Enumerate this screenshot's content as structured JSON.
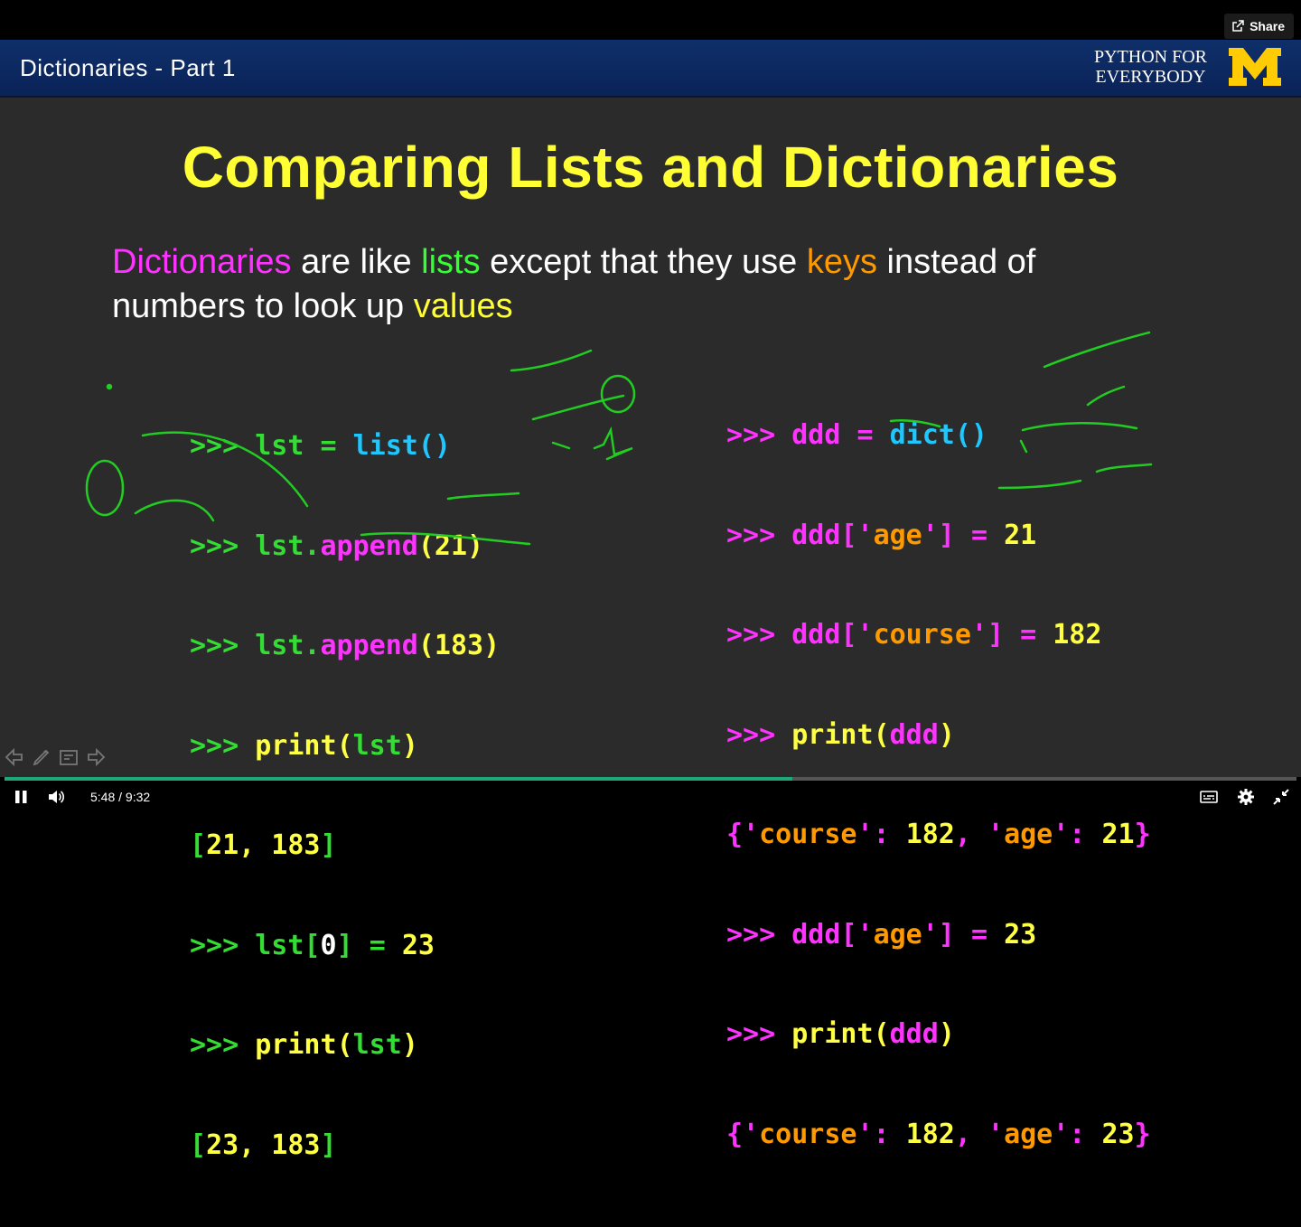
{
  "window": {
    "share_label": "Share"
  },
  "header": {
    "lecture_title": "Dictionaries - Part 1",
    "brand_line1": "PYTHON FOR",
    "brand_line2": "EVERYBODY",
    "logo_letter": "M"
  },
  "slide": {
    "title": "Comparing Lists and Dictionaries",
    "intro": {
      "w1": "Dictionaries",
      "t1": " are like ",
      "w2": "lists",
      "t2": " except that they use ",
      "w3": "keys",
      "t3": " instead of",
      "t4": "numbers to look up ",
      "w4": "values"
    }
  },
  "code_left": {
    "prompt": ">>>",
    "l1_var": "lst",
    "l1_eq": "=",
    "l1_fn": "list()",
    "l2_var": "lst",
    "l2_dot": ".",
    "l2_fn": "append",
    "l2_args": "(21)",
    "l3_var": "lst",
    "l3_dot": ".",
    "l3_fn": "append",
    "l3_args": "(183)",
    "l4_fn": "print",
    "l4_open": "(",
    "l4_arg": "lst",
    "l4_close": ")",
    "o1_open": "[",
    "o1_body": "21, 183",
    "o1_close": "]",
    "l5_var": "lst",
    "l5_b1": "[",
    "l5_idx": "0",
    "l5_b2": "]",
    "l5_eq": "=",
    "l5_val": "23",
    "l6_fn": "print",
    "l6_open": "(",
    "l6_arg": "lst",
    "l6_close": ")",
    "o2_open": "[",
    "o2_body": "23, 183",
    "o2_close": "]"
  },
  "code_right": {
    "prompt": ">>>",
    "r1_var": "ddd",
    "r1_eq": "=",
    "r1_fn": "dict()",
    "r2_var": "ddd",
    "r2_b1": "['",
    "r2_key": "age",
    "r2_b2": "']",
    "r2_eq": "=",
    "r2_val": "21",
    "r3_var": "ddd",
    "r3_b1": "['",
    "r3_key": "course",
    "r3_b2": "']",
    "r3_eq": "=",
    "r3_val": "182",
    "r4_fn": "print",
    "r4_open": "(",
    "r4_arg": "ddd",
    "r4_close": ")",
    "o1_open": "{'",
    "o1_k1": "course",
    "o1_sep1": "': ",
    "o1_v1": "182",
    "o1_comma": ", '",
    "o1_k2": "age",
    "o1_sep2": "': ",
    "o1_v2": "21",
    "o1_close": "}",
    "r5_var": "ddd",
    "r5_b1": "['",
    "r5_key": "age",
    "r5_b2": "']",
    "r5_eq": "=",
    "r5_val": "23",
    "r6_fn": "print",
    "r6_open": "(",
    "r6_arg": "ddd",
    "r6_close": ")",
    "o2_open": "{'",
    "o2_k1": "course",
    "o2_sep1": "': ",
    "o2_v1": "182",
    "o2_comma": ", '",
    "o2_k2": "age",
    "o2_sep2": "': ",
    "o2_v2": "23",
    "o2_close": "}"
  },
  "player": {
    "current_time": "5:48",
    "time_sep": "/",
    "duration": "9:32",
    "progress": 0.61,
    "accent": "#1ca87a"
  },
  "icons": {
    "share": "share-icon",
    "pause": "pause-icon",
    "volume": "volume-icon",
    "captions": "captions-icon",
    "settings": "gear-icon",
    "exit_fullscreen": "exit-fullscreen-icon",
    "slide_prev": "arrow-left-icon",
    "slide_pen": "pen-icon",
    "slide_notes": "notes-icon",
    "slide_next": "arrow-right-icon"
  }
}
